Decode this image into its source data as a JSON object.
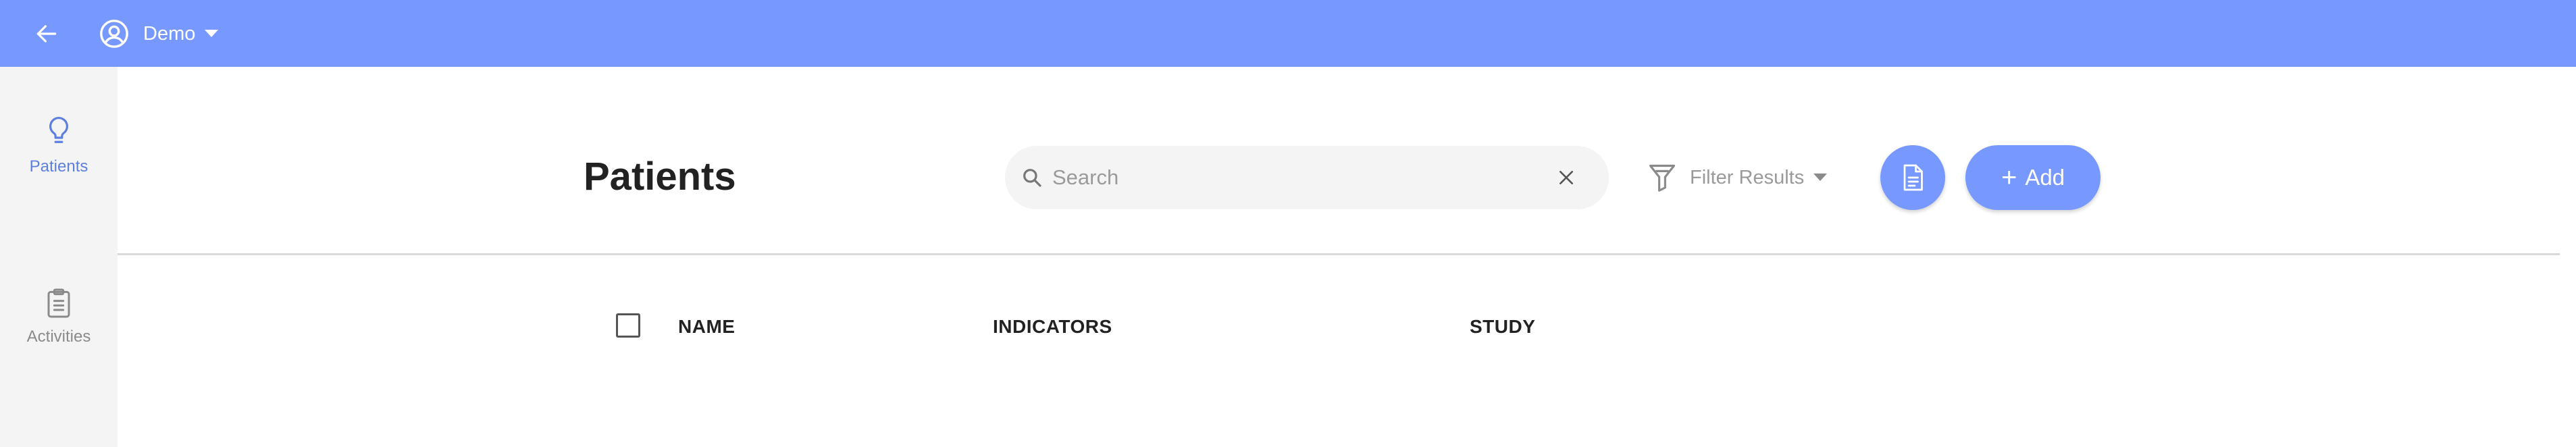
{
  "header": {
    "user_label": "Demo",
    "accent_color": "#7799ff"
  },
  "sidebar": {
    "items": [
      {
        "label": "Patients",
        "icon": "lightbulb-icon",
        "active": true
      },
      {
        "label": "Activities",
        "icon": "clipboard-icon",
        "active": false
      }
    ]
  },
  "main": {
    "title": "Patients",
    "search": {
      "placeholder": "Search",
      "value": ""
    },
    "filter_label": "Filter Results",
    "add_label": "Add",
    "table": {
      "columns": [
        "NAME",
        "INDICATORS",
        "STUDY"
      ],
      "rows": []
    }
  }
}
